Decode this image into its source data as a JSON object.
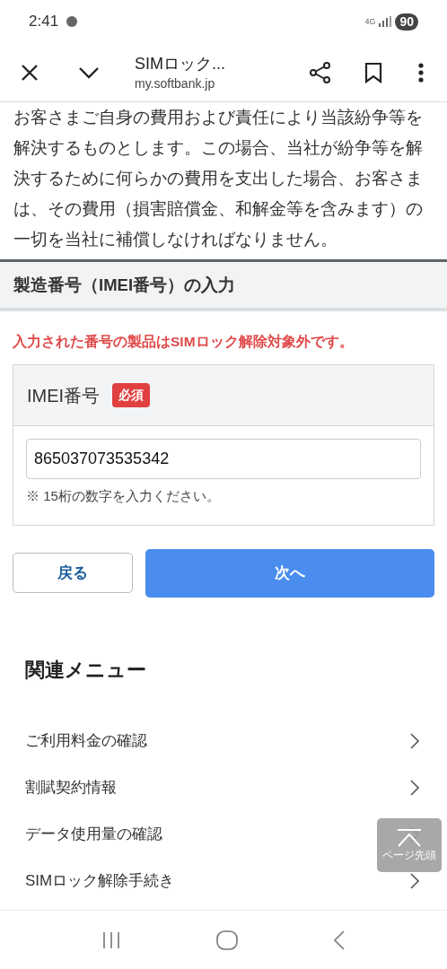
{
  "status_bar": {
    "time": "2:41",
    "network": "4G",
    "battery": "90"
  },
  "toolbar": {
    "title": "SIMロック...",
    "url": "my.softbank.jp"
  },
  "paragraph_lines": [
    "お客さまご自身の費用および責任により当該紛争等を",
    "解決するものとします。この場合、当社が紛争等を解",
    "決するために何らかの費用を支出した場合、お客さま",
    "は、その費用（損害賠償金、和解金等を含みます）の",
    "一切を当社に補償しなければなりません。"
  ],
  "section_title": "製造番号（IMEI番号）の入力",
  "error_message": "入力された番号の製品はSIMロック解除対象外です。",
  "imei_field": {
    "label": "IMEI番号",
    "badge": "必須",
    "value": "865037073535342",
    "hint": "※ 15桁の数字を入力ください。"
  },
  "buttons": {
    "back": "戻る",
    "next": "次へ"
  },
  "related_menu": {
    "title": "関連メニュー",
    "items": [
      "ご利用料金の確認",
      "割賦契約情報",
      "データ使用量の確認",
      "SIMロック解除手続き"
    ]
  },
  "back_to_top": {
    "label": "ページ先頭"
  }
}
